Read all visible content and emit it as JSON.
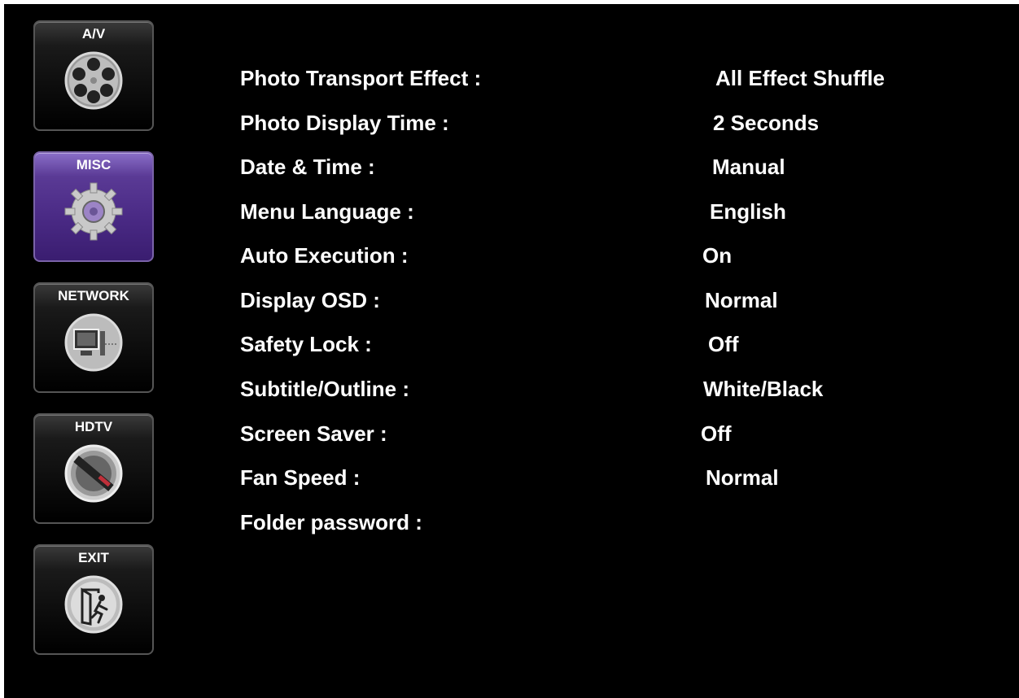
{
  "sidebar": {
    "items": [
      {
        "label": "A/V",
        "icon": "film-reel-icon"
      },
      {
        "label": "MISC",
        "icon": "gear-icon"
      },
      {
        "label": "NETWORK",
        "icon": "computer-icon"
      },
      {
        "label": "HDTV",
        "icon": "hdtv-dial-icon"
      },
      {
        "label": "EXIT",
        "icon": "exit-door-icon"
      }
    ],
    "active": "MISC"
  },
  "settings": [
    {
      "label": "Photo Transport Effect :",
      "value": "All Effect Shuffle"
    },
    {
      "label": "Photo Display Time :",
      "value": "2 Seconds"
    },
    {
      "label": "Date & Time :",
      "value": "Manual"
    },
    {
      "label": "Menu Language :",
      "value": "English"
    },
    {
      "label": "Auto Execution :",
      "value": "On"
    },
    {
      "label": "Display OSD :",
      "value": "Normal"
    },
    {
      "label": "Safety Lock :",
      "value": "Off"
    },
    {
      "label": "Subtitle/Outline :",
      "value": "White/Black"
    },
    {
      "label": "Screen Saver :",
      "value": "Off"
    },
    {
      "label": "Fan Speed :",
      "value": "Normal"
    },
    {
      "label": "Folder password :",
      "value": ""
    }
  ],
  "colors": {
    "background": "#000000",
    "text": "#ffffff",
    "active_tile": "#5a3a95"
  }
}
